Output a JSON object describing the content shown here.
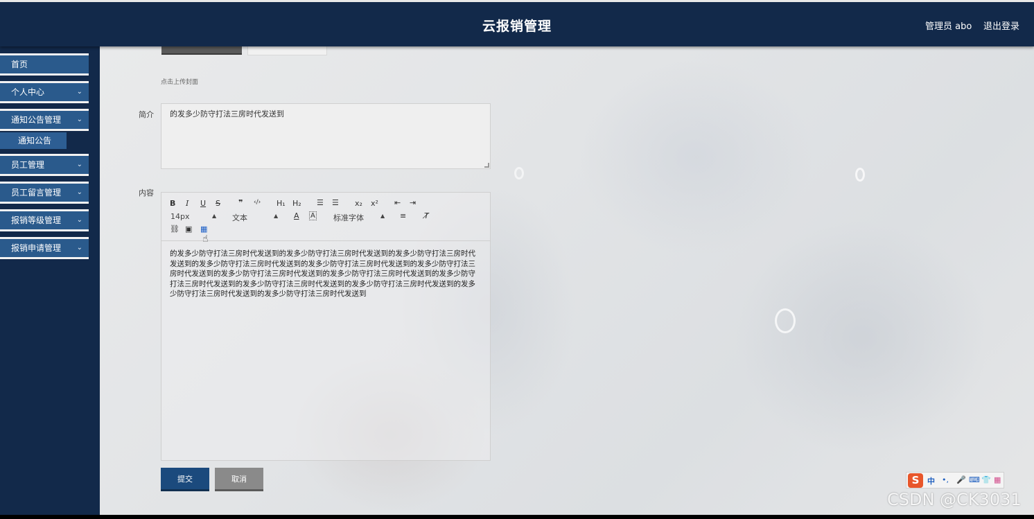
{
  "header": {
    "title": "云报销管理",
    "user_label": "管理员 abo",
    "logout_label": "退出登录"
  },
  "sidebar": {
    "items": [
      {
        "label": "首页"
      },
      {
        "label": "个人中心"
      },
      {
        "label": "通知公告管理"
      },
      {
        "label": "员工管理"
      },
      {
        "label": "员工留言管理"
      },
      {
        "label": "报销等级管理"
      },
      {
        "label": "报销申请管理"
      }
    ],
    "subitem": {
      "label": "通知公告"
    }
  },
  "form": {
    "upload_hint": "点击上传封面",
    "summary_label": "简介",
    "summary_value": "的发多少防守打法三房时代发送到",
    "content_label": "内容",
    "content_text": "的发多少防守打法三房时代发送到的发多少防守打法三房时代发送到的发多少防守打法三房时代发送到的发多少防守打法三房时代发送到的发多少防守打法三房时代发送到的发多少防守打法三房时代发送到的发多少防守打法三房时代发送到的发多少防守打法三房时代发送到的发多少防守打法三房时代发送到的发多少防守打法三房时代发送到的发多少防守打法三房时代发送到的发多少防守打法三房时代发送到的发多少防守打法三房时代发送到",
    "submit_label": "提交",
    "cancel_label": "取消"
  },
  "editor_toolbar": {
    "font_size": "14px",
    "block_type": "文本",
    "font_family": "标准字体",
    "buttons": [
      "bold-icon",
      "italic-icon",
      "underline-icon",
      "strikethrough-icon",
      "blockquote-icon",
      "code-block-icon",
      "header1-icon",
      "header2-icon",
      "ordered-list-icon",
      "bullet-list-icon",
      "subscript-icon",
      "superscript-icon",
      "outdent-icon",
      "indent-icon",
      "font-color-icon",
      "background-color-icon",
      "align-icon",
      "clear-format-icon",
      "link-icon",
      "image-icon",
      "video-icon"
    ],
    "labels": {
      "bold": "B",
      "italic": "I",
      "underline": "U",
      "strike": "S",
      "quote": "❞",
      "code": "‹/›",
      "h1": "H₁",
      "h2": "H₂",
      "ol": "☰",
      "ul": "☰",
      "sub": "x₂",
      "sup": "x²",
      "outdent": "⇤",
      "indent": "⇥",
      "color": "A",
      "bg": "A",
      "align": "≡",
      "clean": "T̸",
      "link": "⛓",
      "image": "▣",
      "video": "▦"
    }
  },
  "ime": {
    "logo": "S",
    "mode": "中",
    "punct": "•,",
    "mic": "🎤",
    "keyboard": "⌨",
    "skin": "👕",
    "apps": "▦"
  },
  "watermark": "CSDN @CK3031",
  "colors": {
    "header_bg": "#12294a",
    "menu_bg": "#2a5a8c",
    "submit_bg": "#1b4a7d",
    "cancel_bg": "#8a8a8a"
  }
}
